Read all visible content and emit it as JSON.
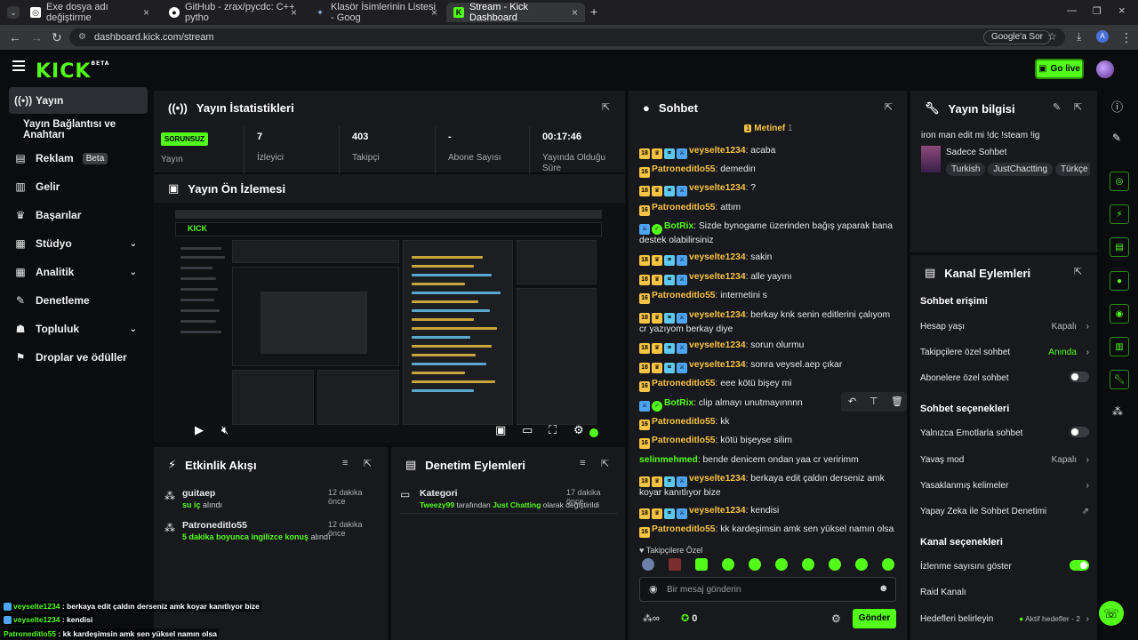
{
  "browser": {
    "tabs": [
      {
        "title": "Exe dosya adı değiştirme"
      },
      {
        "title": "GitHub - zrax/pycdc: C++ pytho"
      },
      {
        "title": "Klasör İsimlerinin Listesi - Goog"
      },
      {
        "title": "Stream - Kick Dashboard"
      }
    ],
    "url": "dashboard.kick.com/stream",
    "google_btn": "Google'a Sor"
  },
  "header": {
    "logo": "KICK",
    "logo_sup": "BETA",
    "go_live": "Go live"
  },
  "sidebar": {
    "items": [
      {
        "label": "Yayın",
        "icon": "broadcast-icon"
      },
      {
        "label": "Yayın Bağlantısı ve Anahtarı"
      },
      {
        "label": "Reklam",
        "badge": "Beta",
        "icon": "ad-icon"
      },
      {
        "label": "Gelir",
        "icon": "chart-icon"
      },
      {
        "label": "Başarılar",
        "icon": "trophy-icon"
      },
      {
        "label": "Stüdyo",
        "icon": "studio-icon"
      },
      {
        "label": "Analitik",
        "icon": "analytics-icon"
      },
      {
        "label": "Denetleme",
        "icon": "wrench-icon"
      },
      {
        "label": "Topluluk",
        "icon": "community-icon"
      },
      {
        "label": "Droplar ve ödüller",
        "icon": "gift-icon"
      }
    ]
  },
  "stats": {
    "title": "Yayın İstatistikleri",
    "status": "SORUNSUZ",
    "status_label": "Yayın",
    "items": [
      {
        "value": "7",
        "label": "İzleyici"
      },
      {
        "value": "403",
        "label": "Takipçi"
      },
      {
        "value": "-",
        "label": "Abone Sayısı"
      },
      {
        "value": "00:17:46",
        "label": "Yayında Olduğu Süre"
      }
    ]
  },
  "preview": {
    "title": "Yayın Ön İzlemesi"
  },
  "activity": {
    "title": "Etkinlik Akışı",
    "items": [
      {
        "user": "guitaep",
        "detail_pre": "",
        "detail_hl": "su iç",
        "detail_post": " alındı",
        "time": "12 dakika önce"
      },
      {
        "user": "Patroneditlo55",
        "detail_pre": "",
        "detail_hl": "5 dakika boyunca ingilizce konuş",
        "detail_post": " alındı",
        "time": "12 dakika önce"
      }
    ]
  },
  "moderation": {
    "title": "Denetim Eylemleri",
    "items": [
      {
        "title": "Kategori",
        "user": "Tweezy99",
        "mid": " tarafından ",
        "hl": "Just Chatting",
        "post": " olarak değiştirildi",
        "time": "17 dakika önce"
      }
    ]
  },
  "chat": {
    "title": "Sohbet",
    "pinned_user": "Metinef",
    "pinned_count": "1",
    "messages": [
      {
        "user": "veyselte1234",
        "text": ": acaba",
        "color": "#f6c344",
        "badges": "full"
      },
      {
        "user": "Patroneditlo55",
        "text": ": demedin",
        "color": "#f6c344",
        "badges": "sub"
      },
      {
        "user": "veyselte1234",
        "text": ": ?",
        "color": "#f6c344",
        "badges": "full"
      },
      {
        "user": "Patroneditlo55",
        "text": ": attım",
        "color": "#f6c344",
        "badges": "sub"
      },
      {
        "user": "BotRix",
        "text": ": Sizde bynogame üzerinden bağış yaparak bana destek olabilirsiniz",
        "color": "#53fc18",
        "badges": "bot"
      },
      {
        "user": "veyselte1234",
        "text": ": sakin",
        "color": "#f6c344",
        "badges": "full"
      },
      {
        "user": "veyselte1234",
        "text": ": alle yayını",
        "color": "#f6c344",
        "badges": "full"
      },
      {
        "user": "Patroneditlo55",
        "text": ": internetini s",
        "color": "#f6c344",
        "badges": "sub"
      },
      {
        "user": "veyselte1234",
        "text": ": berkay knk senin editlerini çalıyom cr yazıyom berkay diye",
        "color": "#f6c344",
        "badges": "full"
      },
      {
        "user": "veyselte1234",
        "text": ": sorun olurmu",
        "color": "#f6c344",
        "badges": "full"
      },
      {
        "user": "veyselte1234",
        "text": ": sonra veysel.aep çıkar",
        "color": "#f6c344",
        "badges": "full"
      },
      {
        "user": "Patroneditlo55",
        "text": ": eee kötü bişey mi",
        "color": "#f6c344",
        "badges": "sub"
      },
      {
        "user": "BotRix",
        "text": ": clip almayı unutmayınnnn",
        "color": "#53fc18",
        "badges": "bot"
      },
      {
        "user": "Patroneditlo55",
        "text": ": kk",
        "color": "#f6c344",
        "badges": "sub"
      },
      {
        "user": "Patroneditlo55",
        "text": ": kötü bişeyse silim",
        "color": "#f6c344",
        "badges": "sub"
      },
      {
        "user": "selinmehmed",
        "text": ": bende denicem ondan yaa cr veririmm",
        "color": "#53fc18",
        "badges": "none"
      },
      {
        "user": "veyselte1234",
        "text": ": berkaya edit çaldın derseniz amk koyar kanıtlıyor bize",
        "color": "#f6c344",
        "badges": "full"
      },
      {
        "user": "veyselte1234",
        "text": ": kendisi",
        "color": "#f6c344",
        "badges": "full"
      },
      {
        "user": "Patroneditlo55",
        "text": ": kk kardeşimsin amk sen yüksel namın olsa",
        "color": "#f6c344",
        "badges": "sub"
      }
    ],
    "followers_only": "Takipçilere Özel",
    "input_placeholder": "Bir mesaj gönderin",
    "points": "0",
    "send": "Gönder"
  },
  "info": {
    "title": "Yayın bilgisi",
    "stream_title": "iron man edit mi !dc !steam !ig",
    "category": "Sadece Sohbet",
    "tags": [
      "Turkish",
      "JustChactting",
      "Türkçe"
    ]
  },
  "channel_actions": {
    "title": "Kanal Eylemleri",
    "chat_access": "Sohbet erişimi",
    "rows1": [
      {
        "label": "Hesap yaşı",
        "value": "Kapalı"
      },
      {
        "label": "Takipçilere özel sohbet",
        "value": "Anında"
      },
      {
        "label": "Abonelere özel sohbet",
        "value": ""
      }
    ],
    "chat_options": "Sohbet seçenekleri",
    "rows2": [
      {
        "label": "Yalnızca Emotlarla sohbet",
        "value": ""
      },
      {
        "label": "Yavaş mod",
        "value": "Kapalı"
      },
      {
        "label": "Yasaklanmış kelimeler",
        "value": ""
      },
      {
        "label": "Yapay Zeka ile Sohbet Denetimi",
        "value": ""
      }
    ],
    "channel_options": "Kanal seçenekleri",
    "rows3": [
      {
        "label": "İzlenme sayısını göster",
        "value": ""
      },
      {
        "label": "Raid Kanalı",
        "value": ""
      },
      {
        "label": "Hedefleri belirleyin",
        "value": "Aktif hedefler - 2"
      }
    ]
  },
  "overlay": {
    "lines": [
      {
        "user": "veyselte1234",
        "text": " : berkaya edit çaldın derseniz amk koyar kanıtlıyor bize"
      },
      {
        "user": "veyselte1234",
        "text": " : kendisi"
      },
      {
        "user": "Patroneditlo55",
        "text": " : kk kardeşimsin amk sen yüksel namın olsa"
      }
    ]
  },
  "colors": {
    "accent": "#53fc18",
    "panel": "#18191c",
    "bg": "#0b0c0e"
  }
}
